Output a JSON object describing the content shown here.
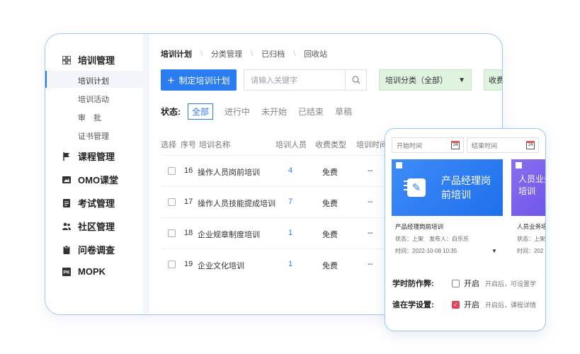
{
  "sidebar": {
    "items": [
      {
        "label": "培训管理",
        "icon": "grid-icon"
      },
      {
        "label": "课程管理",
        "icon": "flag-icon"
      },
      {
        "label": "OMO课堂",
        "icon": "image-icon"
      },
      {
        "label": "考试管理",
        "icon": "document-icon"
      },
      {
        "label": "社区管理",
        "icon": "users-icon"
      },
      {
        "label": "问卷调查",
        "icon": "clipboard-icon"
      },
      {
        "label": "MOPK",
        "icon": "pk-icon"
      }
    ],
    "sub_items": [
      "培训计划",
      "培训活动",
      "审　批",
      "证书管理"
    ]
  },
  "tabs": [
    "培训计划",
    "分类管理",
    "已归档",
    "回收站"
  ],
  "toolbar": {
    "create_label": "制定培训计划",
    "search_placeholder": "请输入关键字",
    "category_select": "培训分类（全部）",
    "fee_select": "收费"
  },
  "status_filter": {
    "label": "状态:",
    "options": [
      "全部",
      "进行中",
      "未开始",
      "已结束",
      "草稿"
    ]
  },
  "table": {
    "headers": [
      "选择",
      "序号",
      "培训名称",
      "培训人员",
      "收费类型",
      "培训时间"
    ],
    "rows": [
      {
        "no": "16",
        "name": "操作人员岗前培训",
        "people": "4",
        "fee": "免费",
        "time": "--"
      },
      {
        "no": "17",
        "name": "操作人员技能提成培训",
        "people": "7",
        "fee": "免费",
        "time": "--"
      },
      {
        "no": "18",
        "name": "企业规章制度培训",
        "people": "1",
        "fee": "免费",
        "time": "--"
      },
      {
        "no": "19",
        "name": "企业文化培训",
        "people": "1",
        "fee": "免费",
        "time": "--"
      }
    ]
  },
  "card": {
    "start_placeholder": "开始时间",
    "end_placeholder": "结束时间",
    "calendar_day": "24",
    "course1": {
      "cover_title": "产品经理岗前培训",
      "name": "产品经理岗前培训",
      "status_line": "状态：上架　发布人：白乐乐",
      "time_line": "时间：2022-10-08 10:35"
    },
    "course2": {
      "cover_title": "人员业务培训",
      "name": "人员业务培",
      "status_line": "状态：上架",
      "time_line": "时间：202"
    },
    "anti_cheat": {
      "label": "学时防作弊:",
      "toggle": "开启",
      "hint": "开启后，可设置学"
    },
    "who_learning": {
      "label": "谁在学设置:",
      "toggle": "开启",
      "hint": "开启后，课程详情"
    }
  }
}
